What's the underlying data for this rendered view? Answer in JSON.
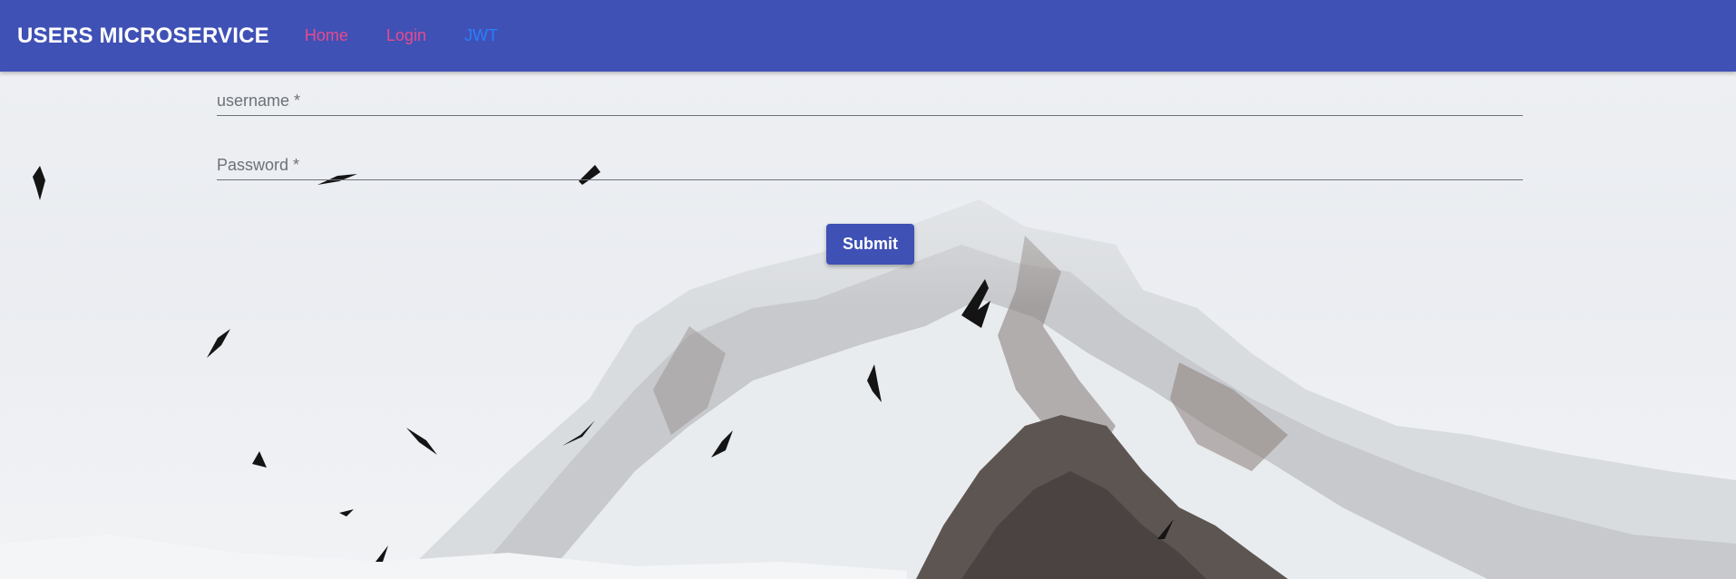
{
  "navbar": {
    "brand": "USERS MICROSERVICE",
    "links": [
      {
        "label": "Home",
        "color": "#e84a8c"
      },
      {
        "label": "Login",
        "color": "#e84a8c"
      },
      {
        "label": "JWT",
        "color": "#2a7fff"
      }
    ],
    "background": "#3f51b5"
  },
  "form": {
    "username_label": "username *",
    "password_label": "Password *",
    "submit_label": "Submit"
  },
  "background": {
    "image": "mountain-with-birds-illustration",
    "colors": {
      "sky": "#e8ebef",
      "snow": "#f2f4f6",
      "rock": "#5a5350"
    }
  }
}
